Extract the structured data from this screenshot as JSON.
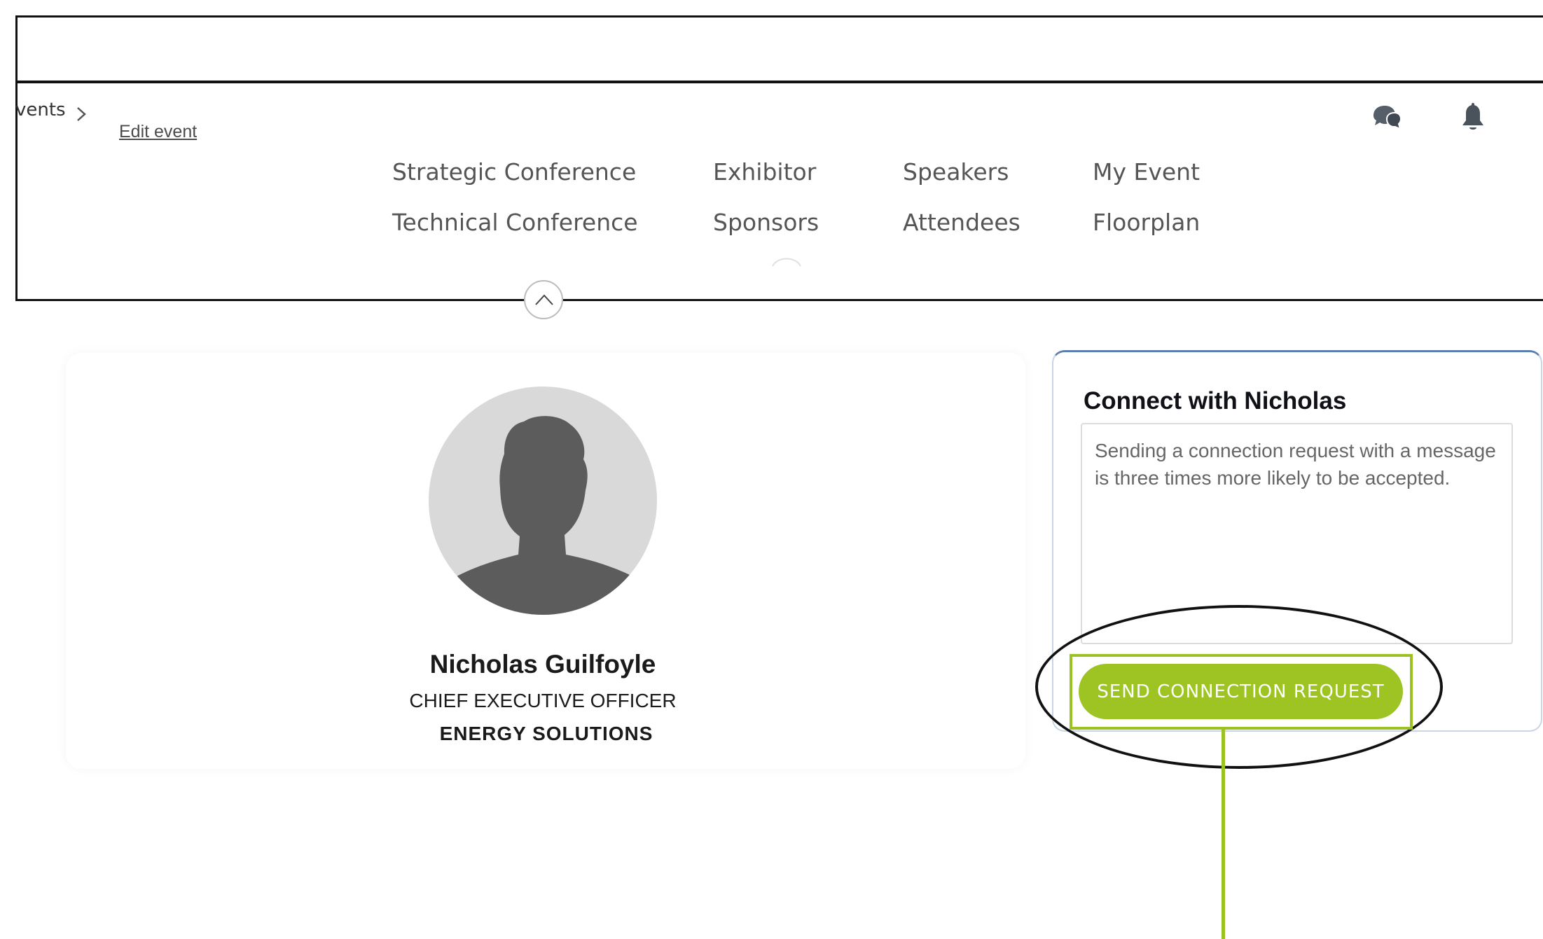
{
  "header": {
    "breadcrumb_prev": "vents",
    "edit_event_label": "Edit event",
    "icons": {
      "chat": "chat-bubbles-icon",
      "notifications": "bell-icon",
      "collapse": "chevron-up-icon",
      "breadcrumb_separator": "chevron-right-icon"
    }
  },
  "nav": {
    "items": [
      {
        "label": "Strategic Conference"
      },
      {
        "label": "Technical Conference"
      },
      {
        "label": "Exhibitor"
      },
      {
        "label": "Sponsors"
      },
      {
        "label": "Speakers"
      },
      {
        "label": "Attendees"
      },
      {
        "label": "My Event"
      },
      {
        "label": "Floorplan"
      }
    ]
  },
  "profile": {
    "name": "Nicholas Guilfoyle",
    "title": "CHIEF EXECUTIVE OFFICER",
    "company": "ENERGY SOLUTIONS",
    "avatar_icon": "default-person-avatar"
  },
  "connect": {
    "heading": "Connect with Nicholas",
    "message_placeholder": "Sending a connection request with a message is three times more likely to be accepted.",
    "message_value": "",
    "button_label": "SEND CONNECTION REQUEST"
  },
  "colors": {
    "accent_green": "#9dc423",
    "annotation_black": "#111111",
    "panel_border_blue": "#5a7fae",
    "avatar_bg": "#d9d9d9",
    "avatar_silhouette": "#5c5c5c"
  }
}
